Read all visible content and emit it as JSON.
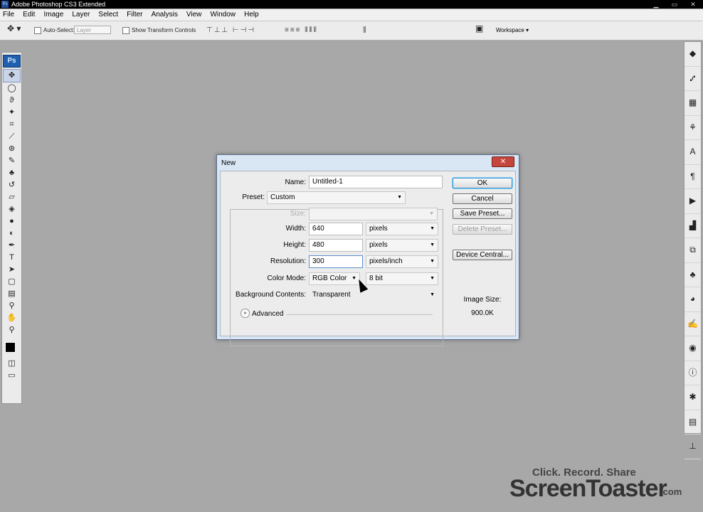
{
  "app": {
    "title": "Adobe Photoshop CS3 Extended",
    "ps_mini": "Ps"
  },
  "menu": [
    "File",
    "Edit",
    "Image",
    "Layer",
    "Select",
    "Filter",
    "Analysis",
    "View",
    "Window",
    "Help"
  ],
  "options": {
    "auto_select": "Auto-Select:",
    "layer_select": "Layer",
    "show_transform": "Show Transform Controls",
    "workspace": "Workspace ▾"
  },
  "toolbox": {
    "logo": "Ps"
  },
  "dialog": {
    "title": "New",
    "close": "✕",
    "name_label": "Name:",
    "name_value": "Untitled-1",
    "preset_label": "Preset:",
    "preset_value": "Custom",
    "size_label": "Size:",
    "width_label": "Width:",
    "width_value": "640",
    "width_unit": "pixels",
    "height_label": "Height:",
    "height_value": "480",
    "height_unit": "pixels",
    "resolution_label": "Resolution:",
    "resolution_value": "300",
    "resolution_unit": "pixels/inch",
    "color_mode_label": "Color Mode:",
    "color_mode_value": "RGB Color",
    "bit_depth_value": "8 bit",
    "background_label": "Background Contents:",
    "background_value": "Transparent",
    "advanced": "Advanced",
    "ok": "OK",
    "cancel": "Cancel",
    "save_preset": "Save Preset...",
    "delete_preset": "Delete Preset...",
    "device_central": "Device Central...",
    "image_size_label": "Image Size:",
    "image_size_value": "900.0K"
  },
  "watermark": {
    "line1": "Click. Record. Share",
    "line2": "ScreenToaster",
    "line3": ".com"
  }
}
